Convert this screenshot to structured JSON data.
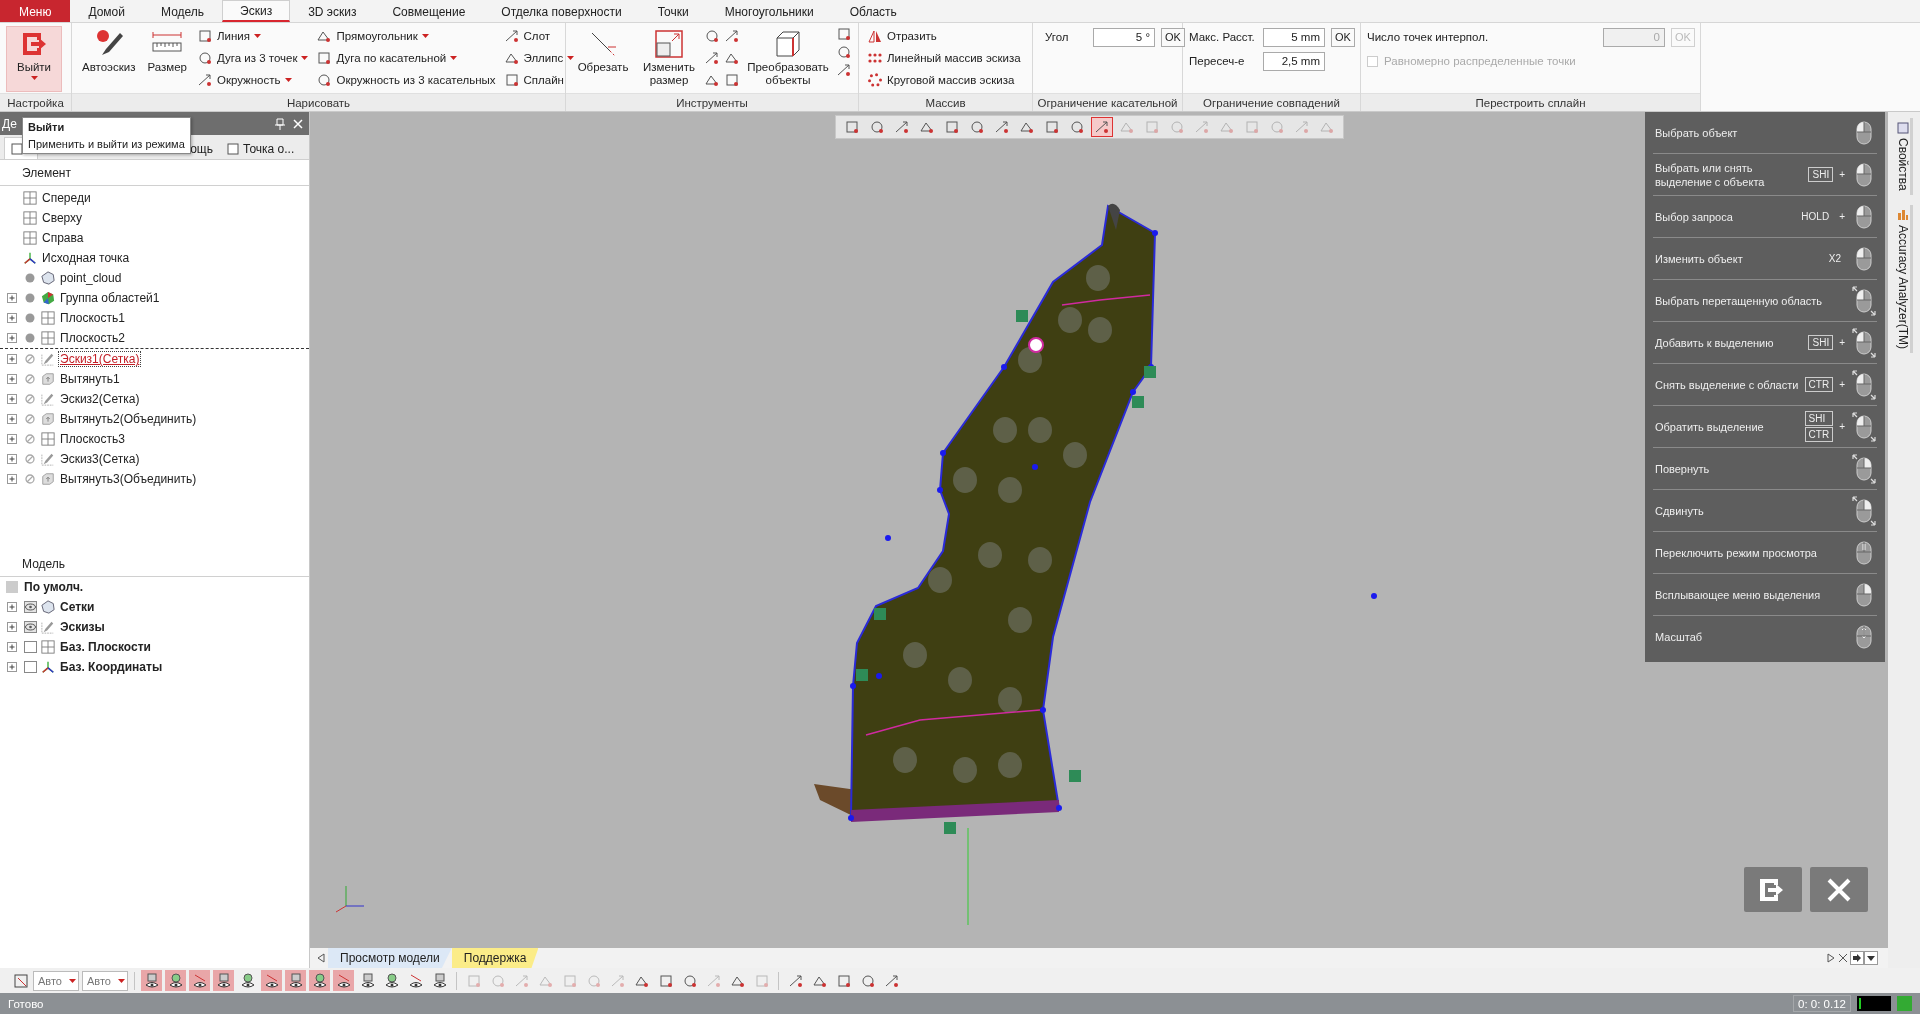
{
  "menu_tabs": [
    {
      "label": "Меню",
      "kind": "app"
    },
    {
      "label": "Домой",
      "kind": "tab",
      "selected": false
    },
    {
      "label": "Модель",
      "kind": "tab",
      "selected": false
    },
    {
      "label": "Эскиз",
      "kind": "tab",
      "selected": true
    },
    {
      "label": "3D эскиз",
      "kind": "tab",
      "selected": false
    },
    {
      "label": "Совмещение",
      "kind": "tab",
      "selected": false
    },
    {
      "label": "Отделка поверхности",
      "kind": "tab",
      "selected": false
    },
    {
      "label": "Точки",
      "kind": "tab",
      "selected": false
    },
    {
      "label": "Многоугольники",
      "kind": "tab",
      "selected": false
    },
    {
      "label": "Область",
      "kind": "tab",
      "selected": false
    }
  ],
  "ribbon": {
    "setup": {
      "title": "Настройка",
      "exit_button": {
        "label": "Выйти",
        "hovered": true
      }
    },
    "draw": {
      "title": "Нарисовать",
      "large": [
        {
          "label": "Автоэскиз"
        },
        {
          "label": "Размер"
        }
      ],
      "columns": [
        [
          {
            "label": "Линия",
            "dropdown": true
          },
          {
            "label": "Дуга из 3 точек",
            "dropdown": true
          },
          {
            "label": "Окружность",
            "dropdown": true
          }
        ],
        [
          {
            "label": "Прямоугольник",
            "dropdown": true
          },
          {
            "label": "Дуга по касательной",
            "dropdown": true
          },
          {
            "label": "Окружность из 3 касательных",
            "dropdown": false
          }
        ],
        [
          {
            "label": "Слот",
            "dropdown": false
          },
          {
            "label": "Эллипс",
            "dropdown": true
          },
          {
            "label": "Сплайн",
            "dropdown": false
          }
        ]
      ]
    },
    "tools": {
      "title": "Инструменты",
      "large": [
        {
          "label": "Обрезать"
        },
        {
          "label": "Изменить размер"
        }
      ],
      "convert": {
        "label": "Преобразовать объекты"
      }
    },
    "pattern": {
      "title": "Массив",
      "items": [
        {
          "label": "Отразить"
        },
        {
          "label": "Линейный массив эскиза"
        },
        {
          "label": "Круговой массив эскиза"
        }
      ]
    },
    "tangent": {
      "title": "Ограничение касательной",
      "label": "Угол",
      "value": "5 °",
      "ok": "OK"
    },
    "coincident": {
      "title": "Ограничение совпадений",
      "rows": [
        {
          "label": "Макс. Расст.",
          "value": "5 mm",
          "ok": "OK"
        },
        {
          "label": "Пересеч-е",
          "value": "2,5 mm"
        }
      ]
    },
    "spline": {
      "title": "Перестроить сплайн",
      "label": "Число точек интерпол.",
      "value": "0",
      "ok": "OK",
      "disabled": true,
      "checkbox": {
        "label": "Равномерно распределенные точки",
        "checked": false,
        "disabled": true
      }
    }
  },
  "tooltip": {
    "title": "Выйти",
    "text": "Применить и выйти из режима"
  },
  "left_panel": {
    "title": "Де",
    "tabs": [
      {
        "selected": true
      },
      {
        "label": "ощь",
        "selected": false
      },
      {
        "label": "Точка о...",
        "selected": false
      }
    ],
    "tree_header": "Элемент",
    "tree": [
      {
        "label": "Спереди",
        "kind": "plane",
        "expander": false,
        "selected": false
      },
      {
        "label": "Сверху",
        "kind": "plane",
        "expander": false,
        "selected": false
      },
      {
        "label": "Справа",
        "kind": "plane",
        "expander": false,
        "selected": false
      },
      {
        "label": "Исходная точка",
        "kind": "origin",
        "expander": false,
        "selected": false
      },
      {
        "label": "point_cloud",
        "kind": "mesh",
        "shown": true,
        "expander": false,
        "selected": false
      },
      {
        "label": "Группа областей1",
        "kind": "regions",
        "shown": true,
        "expander": true,
        "selected": false
      },
      {
        "label": "Плоскость1",
        "kind": "plane",
        "shown": true,
        "expander": true,
        "selected": false
      },
      {
        "label": "Плоскость2",
        "kind": "plane",
        "shown": true,
        "expander": true,
        "selected": false
      },
      {
        "label": "Эскиз1(Сетка)",
        "kind": "sketch",
        "shown": false,
        "expander": true,
        "selected": true
      },
      {
        "label": "Вытянуть1",
        "kind": "extrude",
        "shown": false,
        "expander": true,
        "selected": false
      },
      {
        "label": "Эскиз2(Сетка)",
        "kind": "sketch",
        "shown": false,
        "expander": true,
        "selected": false
      },
      {
        "label": "Вытянуть2(Объединить)",
        "kind": "extrude",
        "shown": false,
        "expander": true,
        "selected": false
      },
      {
        "label": "Плоскость3",
        "kind": "plane",
        "shown": false,
        "expander": true,
        "selected": false
      },
      {
        "label": "Эскиз3(Сетка)",
        "kind": "sketch",
        "shown": false,
        "expander": true,
        "selected": false
      },
      {
        "label": "Вытянуть3(Объединить)",
        "kind": "extrude",
        "shown": false,
        "expander": true,
        "selected": false
      }
    ],
    "model_header": "Модель",
    "model": [
      {
        "label": "По умолч.",
        "kind": "default",
        "expander": false
      },
      {
        "label": "Сетки",
        "kind": "mesh",
        "expander": true,
        "eye_on": true
      },
      {
        "label": "Эскизы",
        "kind": "sketch",
        "expander": true,
        "eye_on": true
      },
      {
        "label": "Баз. Плоскости",
        "kind": "plane",
        "expander": true,
        "eye_on": false
      },
      {
        "label": "Баз. Координаты",
        "kind": "origin",
        "expander": true,
        "eye_on": false
      }
    ]
  },
  "viewport_toolbar": [
    {
      "disabled": false,
      "selected": false
    },
    {
      "disabled": false,
      "selected": false
    },
    {
      "disabled": false,
      "selected": false
    },
    {
      "disabled": false,
      "selected": false
    },
    {
      "disabled": false,
      "selected": false
    },
    {
      "disabled": false,
      "selected": false
    },
    {
      "disabled": false,
      "selected": false
    },
    {
      "disabled": false,
      "selected": false
    },
    {
      "disabled": false,
      "selected": false
    },
    {
      "disabled": false,
      "selected": false
    },
    {
      "disabled": false,
      "selected": true
    },
    {
      "disabled": true,
      "selected": false
    },
    {
      "disabled": true,
      "selected": false
    },
    {
      "disabled": true,
      "selected": false
    },
    {
      "disabled": true,
      "selected": false
    },
    {
      "disabled": true,
      "selected": false
    },
    {
      "disabled": true,
      "selected": false
    },
    {
      "disabled": true,
      "selected": false
    },
    {
      "disabled": true,
      "selected": false
    },
    {
      "disabled": true,
      "selected": false
    }
  ],
  "mouse_hints": [
    {
      "label": "Выбрать объект",
      "kind": "primary",
      "drag": false
    },
    {
      "label": "Выбрать или снять выделение с объекта",
      "keys": [
        {
          "text": "SHI",
          "boxed": true
        }
      ],
      "plus": "+",
      "kind": "primary",
      "drag": false
    },
    {
      "label": "Выбор запроса",
      "keys": [
        {
          "text": "HOLD",
          "boxed": false
        }
      ],
      "plus": "+",
      "kind": "primary",
      "drag": false
    },
    {
      "label": "Изменить объект",
      "keys": [
        {
          "text": "X2",
          "boxed": false
        }
      ],
      "kind": "primary",
      "drag": false
    },
    {
      "label": "Выбрать перетащенную область",
      "kind": "primary",
      "drag": true
    },
    {
      "label": "Добавить к выделению",
      "keys": [
        {
          "text": "SHI",
          "boxed": true
        }
      ],
      "plus": "+",
      "kind": "primary",
      "drag": true
    },
    {
      "label": "Снять выделение с области",
      "keys": [
        {
          "text": "CTR",
          "boxed": true
        }
      ],
      "plus": "+",
      "kind": "primary",
      "drag": true
    },
    {
      "label": "Обратить выделение",
      "keys": [
        {
          "text": "SHI",
          "boxed": true
        },
        {
          "text": "CTR",
          "boxed": true
        }
      ],
      "plus": "+",
      "kind": "primary",
      "drag": true
    },
    {
      "label": "Повернуть",
      "kind": "secondary",
      "drag": true
    },
    {
      "label": "Сдвинуть",
      "kind": "secondary",
      "drag": true
    },
    {
      "label": "Переключить режим просмотра",
      "kind": "middle",
      "drag": false
    },
    {
      "label": "Всплывающее меню выделения",
      "kind": "secondary",
      "drag": false
    },
    {
      "label": "Масштаб",
      "kind": "wheel",
      "drag": false
    }
  ],
  "side_tabs": [
    {
      "label": "Свойства"
    },
    {
      "label": "Accuracy Analyzer(TM)"
    }
  ],
  "view_tabs": [
    {
      "label": "Просмотр модели",
      "selected": false
    },
    {
      "label": "Поддержка",
      "selected": true
    }
  ],
  "bottom_toolbar": {
    "dropdowns": [
      {
        "value": "Авто"
      },
      {
        "value": "Авто"
      }
    ],
    "view_buttons": [
      {
        "on": true
      },
      {
        "on": true
      },
      {
        "on": true
      },
      {
        "on": true
      },
      {
        "on": false
      },
      {
        "on": true
      },
      {
        "on": true
      },
      {
        "on": true
      },
      {
        "on": true
      },
      {
        "on": false
      },
      {
        "on": false
      },
      {
        "on": false
      },
      {
        "on": false
      }
    ],
    "select_buttons": [
      {
        "disabled": true
      },
      {
        "disabled": true
      },
      {
        "disabled": true
      },
      {
        "disabled": true
      },
      {
        "disabled": true
      },
      {
        "disabled": true
      },
      {
        "disabled": true
      },
      {
        "disabled": false
      },
      {
        "disabled": false
      },
      {
        "disabled": false
      },
      {
        "disabled": true
      },
      {
        "disabled": false
      },
      {
        "disabled": true
      }
    ]
  },
  "status_bar": {
    "text": "Готово",
    "time": "0: 0: 0.12"
  }
}
